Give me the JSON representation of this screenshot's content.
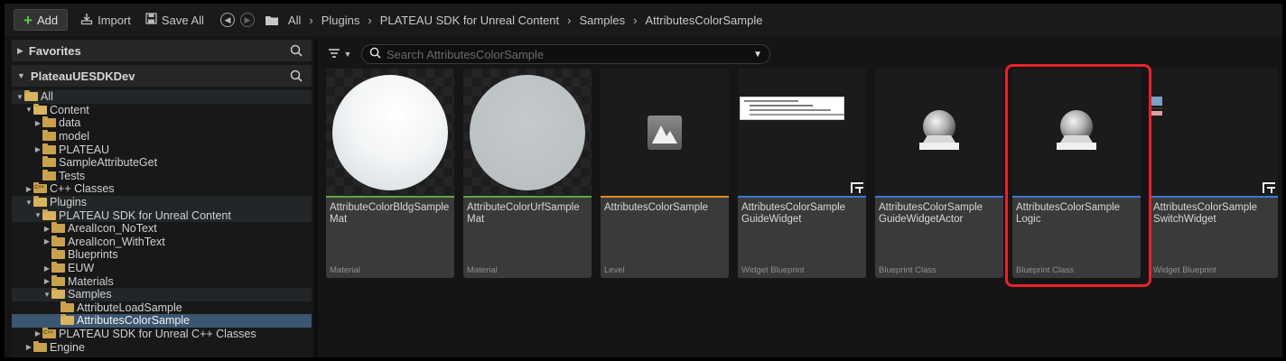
{
  "toolbar": {
    "add_label": "Add",
    "import_label": "Import",
    "save_all_label": "Save All"
  },
  "breadcrumb": [
    "All",
    "Plugins",
    "PLATEAU SDK for Unreal Content",
    "Samples",
    "AttributesColorSample"
  ],
  "sections": {
    "favorites": "Favorites",
    "project": "PlateauUESDKDev"
  },
  "tree": [
    {
      "label": "All",
      "depth": 0,
      "expander": "open",
      "folder": "open",
      "style": "band"
    },
    {
      "label": "Content",
      "depth": 1,
      "expander": "open",
      "folder": "open",
      "style": ""
    },
    {
      "label": "data",
      "depth": 2,
      "expander": "closed",
      "folder": "closed",
      "style": ""
    },
    {
      "label": "model",
      "depth": 2,
      "expander": "none",
      "folder": "closed",
      "style": ""
    },
    {
      "label": "PLATEAU",
      "depth": 2,
      "expander": "closed",
      "folder": "closed",
      "style": ""
    },
    {
      "label": "SampleAttributeGet",
      "depth": 2,
      "expander": "none",
      "folder": "closed",
      "style": ""
    },
    {
      "label": "Tests",
      "depth": 2,
      "expander": "none",
      "folder": "closed",
      "style": ""
    },
    {
      "label": "C++ Classes",
      "depth": 1,
      "expander": "closed",
      "folder": "cpp",
      "style": ""
    },
    {
      "label": "Plugins",
      "depth": 1,
      "expander": "open",
      "folder": "open",
      "style": "band"
    },
    {
      "label": "PLATEAU SDK for Unreal Content",
      "depth": 2,
      "expander": "open",
      "folder": "open",
      "style": "band"
    },
    {
      "label": "ArealIcon_NoText",
      "depth": 3,
      "expander": "closed",
      "folder": "closed",
      "style": ""
    },
    {
      "label": "ArealIcon_WithText",
      "depth": 3,
      "expander": "closed",
      "folder": "closed",
      "style": ""
    },
    {
      "label": "Blueprints",
      "depth": 3,
      "expander": "none",
      "folder": "closed",
      "style": ""
    },
    {
      "label": "EUW",
      "depth": 3,
      "expander": "closed",
      "folder": "closed",
      "style": ""
    },
    {
      "label": "Materials",
      "depth": 3,
      "expander": "closed",
      "folder": "closed",
      "style": ""
    },
    {
      "label": "Samples",
      "depth": 3,
      "expander": "open",
      "folder": "open",
      "style": "band"
    },
    {
      "label": "AttributeLoadSample",
      "depth": 4,
      "expander": "none",
      "folder": "closed",
      "style": ""
    },
    {
      "label": "AttributesColorSample",
      "depth": 4,
      "expander": "none",
      "folder": "open",
      "style": "selected"
    },
    {
      "label": "PLATEAU SDK for Unreal C++ Classes",
      "depth": 2,
      "expander": "closed",
      "folder": "cpp",
      "style": ""
    },
    {
      "label": "Engine",
      "depth": 1,
      "expander": "closed",
      "folder": "closed",
      "style": ""
    }
  ],
  "search": {
    "placeholder": "Search AttributesColorSample"
  },
  "assets": [
    {
      "name": "AttributeColorBldgSample Mat",
      "type": "Material",
      "thumb": "sphere-white",
      "strip_color": "#5fa83f"
    },
    {
      "name": "AttributeColorUrfSample Mat",
      "type": "Material",
      "thumb": "sphere-grey",
      "strip_color": "#5fa83f"
    },
    {
      "name": "AttributesColorSample",
      "type": "Level",
      "thumb": "level-icon",
      "strip_color": "#e08a1e"
    },
    {
      "name": "AttributesColorSample GuideWidget",
      "type": "Widget Blueprint",
      "thumb": "widget-preview",
      "strip_color": "#3a78d8"
    },
    {
      "name": "AttributesColorSample GuideWidgetActor",
      "type": "Blueprint Class",
      "thumb": "blueprint-sphere",
      "strip_color": "#3a78d8"
    },
    {
      "name": "AttributesColorSample Logic",
      "type": "Blueprint Class",
      "thumb": "blueprint-sphere",
      "strip_color": "#3a78d8"
    },
    {
      "name": "AttributesColorSample SwitchWidget",
      "type": "Widget Blueprint",
      "thumb": "widget-switch",
      "strip_color": "#3a78d8"
    }
  ],
  "highlighted_asset": "AttributesColorSample Logic"
}
